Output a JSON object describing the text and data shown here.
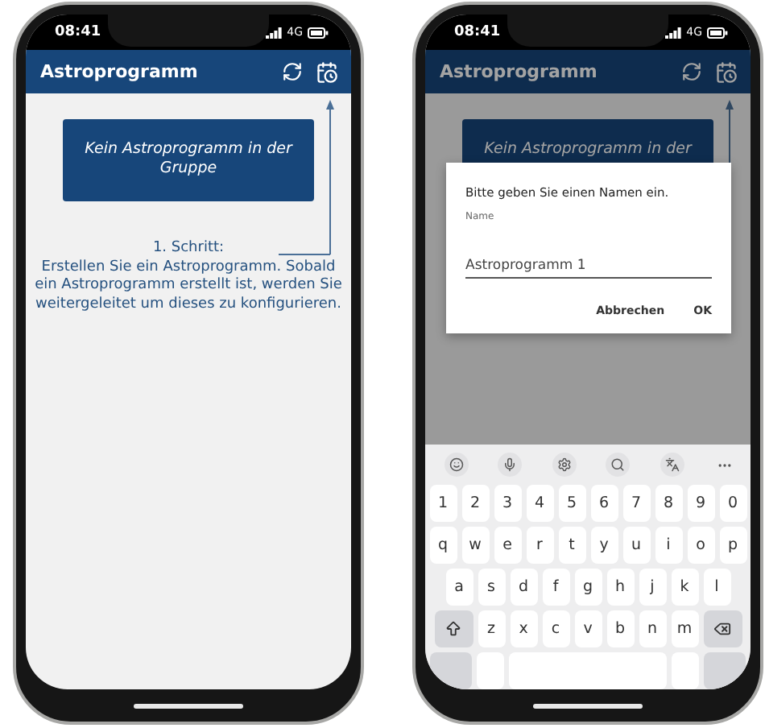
{
  "screens": [
    {
      "status_bar": {
        "time": "08:41",
        "network": "4G"
      },
      "app_bar": {
        "title": "Astroprogramm"
      },
      "empty_button": {
        "label": "Kein Astroprogramm in der Gruppe"
      },
      "hint": {
        "step": "1. Schritt:",
        "text": "Erstellen Sie ein Astroprogramm. Sobald ein Astroprogramm erstellt ist, werden Sie weitergeleitet um dieses zu konfigurieren."
      }
    },
    {
      "status_bar": {
        "time": "08:41",
        "network": "4G"
      },
      "app_bar": {
        "title": "Astroprogramm"
      },
      "empty_button": {
        "label": "Kein Astroprogramm in der"
      },
      "dialog": {
        "title": "Bitte geben Sie einen Namen ein.",
        "field_label": "Name",
        "value": "Astroprogramm 1",
        "buttons": [
          "Abbrechen",
          "OK"
        ]
      },
      "keyboard": {
        "rows": [
          {
            "kind": "plain",
            "keys": [
              "1",
              "2",
              "3",
              "4",
              "5",
              "6",
              "7",
              "8",
              "9",
              "0"
            ]
          },
          {
            "kind": "plain",
            "keys": [
              "q",
              "w",
              "e",
              "r",
              "t",
              "y",
              "u",
              "i",
              "o",
              "p"
            ]
          },
          {
            "kind": "plain",
            "keys": [
              "a",
              "s",
              "d",
              "f",
              "g",
              "h",
              "j",
              "k",
              "l"
            ]
          },
          {
            "kind": "shift",
            "keys": [
              "z",
              "x",
              "c",
              "v",
              "b",
              "n",
              "m"
            ]
          }
        ]
      }
    }
  ]
}
